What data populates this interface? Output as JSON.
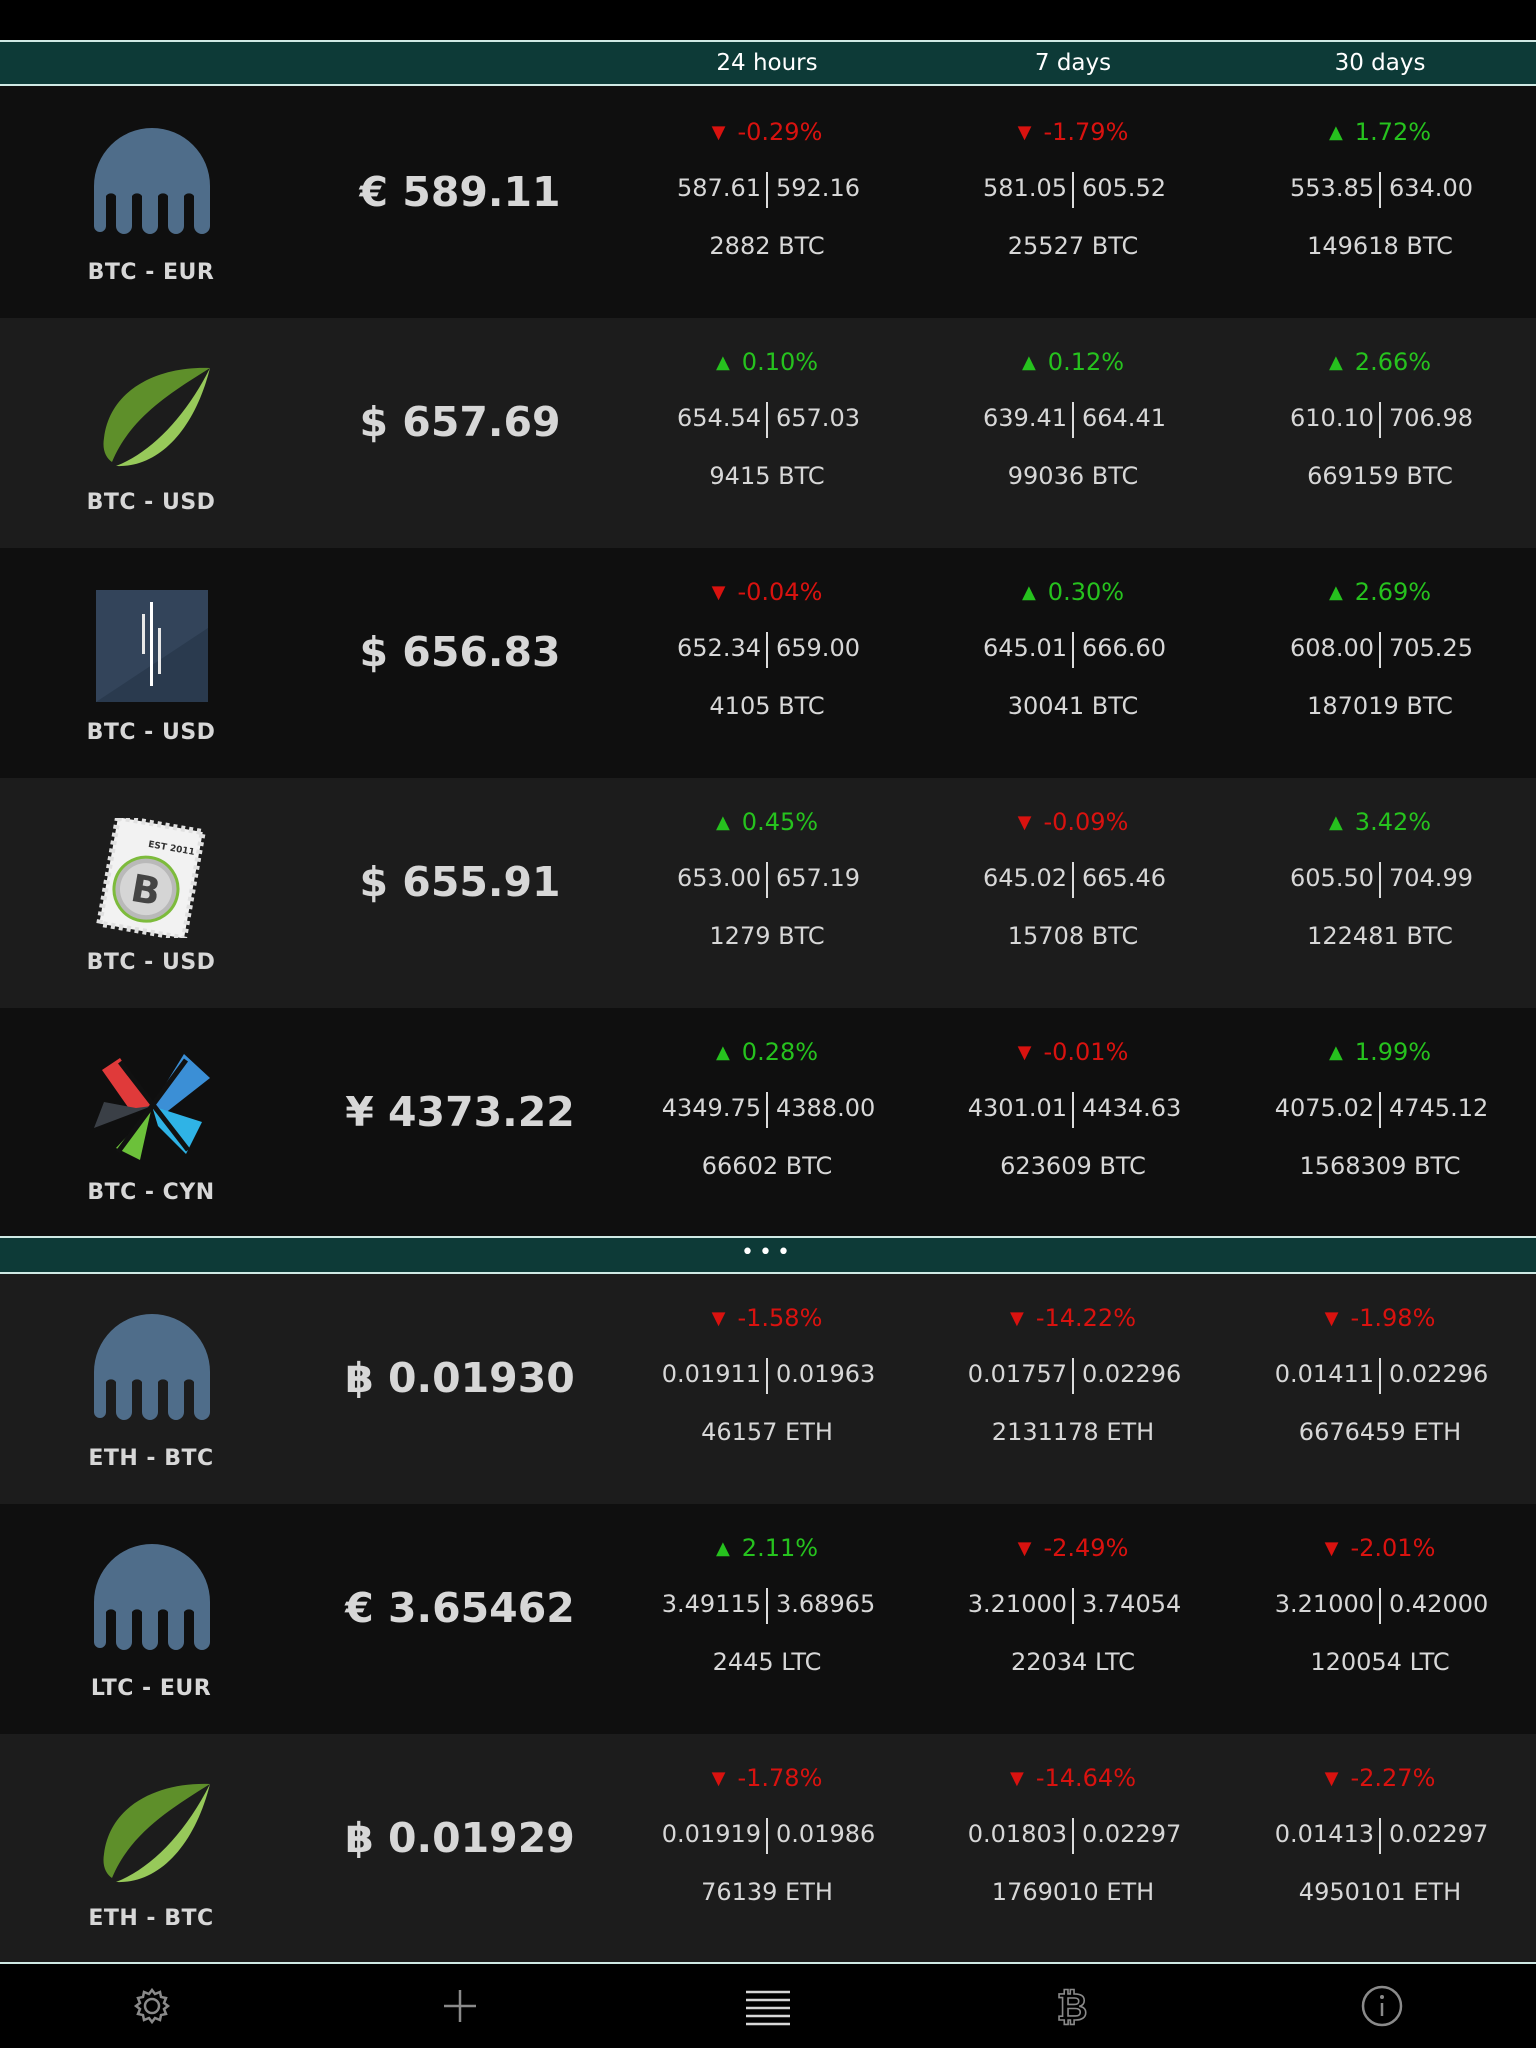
{
  "header": {
    "col_24h": "24 hours",
    "col_7d": "7 days",
    "col_30d": "30 days"
  },
  "divider": {
    "dots": "•••"
  },
  "rows": [
    {
      "logo": "kraken-icon",
      "pair": "BTC - EUR",
      "price": "€ 589.11",
      "h24": {
        "change": "-0.29%",
        "dir": "down",
        "low": "587.61",
        "high": "592.16",
        "volume": "2882 BTC"
      },
      "d7": {
        "change": "-1.79%",
        "dir": "down",
        "low": "581.05",
        "high": "605.52",
        "volume": "25527 BTC"
      },
      "d30": {
        "change": "1.72%",
        "dir": "up",
        "low": "553.85",
        "high": "634.00",
        "volume": "149618 BTC"
      }
    },
    {
      "logo": "bitfinex-leaf-icon",
      "pair": "BTC - USD",
      "price": "$ 657.69",
      "h24": {
        "change": "0.10%",
        "dir": "up",
        "low": "654.54",
        "high": "657.03",
        "volume": "9415 BTC"
      },
      "d7": {
        "change": "0.12%",
        "dir": "up",
        "low": "639.41",
        "high": "664.41",
        "volume": "99036 BTC"
      },
      "d30": {
        "change": "2.66%",
        "dir": "up",
        "low": "610.10",
        "high": "706.98",
        "volume": "669159 BTC"
      }
    },
    {
      "logo": "exchange-bars-icon",
      "pair": "BTC - USD",
      "price": "$ 656.83",
      "h24": {
        "change": "-0.04%",
        "dir": "down",
        "low": "652.34",
        "high": "659.00",
        "volume": "4105 BTC"
      },
      "d7": {
        "change": "0.30%",
        "dir": "up",
        "low": "645.01",
        "high": "666.60",
        "volume": "30041 BTC"
      },
      "d30": {
        "change": "2.69%",
        "dir": "up",
        "low": "608.00",
        "high": "705.25",
        "volume": "187019 BTC"
      }
    },
    {
      "logo": "bitstamp-stamp-icon",
      "pair": "BTC - USD",
      "price": "$ 655.91",
      "logo_text": "EST 2011",
      "h24": {
        "change": "0.45%",
        "dir": "up",
        "low": "653.00",
        "high": "657.19",
        "volume": "1279 BTC"
      },
      "d7": {
        "change": "-0.09%",
        "dir": "down",
        "low": "645.02",
        "high": "665.46",
        "volume": "15708 BTC"
      },
      "d30": {
        "change": "3.42%",
        "dir": "up",
        "low": "605.50",
        "high": "704.99",
        "volume": "122481 BTC"
      }
    },
    {
      "logo": "okcoin-cross-icon",
      "pair": "BTC - CYN",
      "price": "¥ 4373.22",
      "h24": {
        "change": "0.28%",
        "dir": "up",
        "low": "4349.75",
        "high": "4388.00",
        "volume": "66602 BTC"
      },
      "d7": {
        "change": "-0.01%",
        "dir": "down",
        "low": "4301.01",
        "high": "4434.63",
        "volume": "623609 BTC"
      },
      "d30": {
        "change": "1.99%",
        "dir": "up",
        "low": "4075.02",
        "high": "4745.12",
        "volume": "1568309 BTC"
      }
    },
    {
      "logo": "kraken-icon",
      "pair": "ETH - BTC",
      "price": "฿ 0.01930",
      "h24": {
        "change": "-1.58%",
        "dir": "down",
        "low": "0.01911",
        "high": "0.01963",
        "volume": "46157 ETH"
      },
      "d7": {
        "change": "-14.22%",
        "dir": "down",
        "low": "0.01757",
        "high": "0.02296",
        "volume": "2131178 ETH"
      },
      "d30": {
        "change": "-1.98%",
        "dir": "down",
        "low": "0.01411",
        "high": "0.02296",
        "volume": "6676459 ETH"
      }
    },
    {
      "logo": "kraken-icon",
      "pair": "LTC - EUR",
      "price": "€ 3.65462",
      "h24": {
        "change": "2.11%",
        "dir": "up",
        "low": "3.49115",
        "high": "3.68965",
        "volume": "2445 LTC"
      },
      "d7": {
        "change": "-2.49%",
        "dir": "down",
        "low": "3.21000",
        "high": "3.74054",
        "volume": "22034 LTC"
      },
      "d30": {
        "change": "-2.01%",
        "dir": "down",
        "low": "3.21000",
        "high": "0.42000",
        "volume": "120054 LTC"
      }
    },
    {
      "logo": "bitfinex-leaf-icon",
      "pair": "ETH - BTC",
      "price": "฿ 0.01929",
      "h24": {
        "change": "-1.78%",
        "dir": "down",
        "low": "0.01919",
        "high": "0.01986",
        "volume": "76139 ETH"
      },
      "d7": {
        "change": "-14.64%",
        "dir": "down",
        "low": "0.01803",
        "high": "0.02297",
        "volume": "1769010 ETH"
      },
      "d30": {
        "change": "-2.27%",
        "dir": "down",
        "low": "0.01413",
        "high": "0.02297",
        "volume": "4950101 ETH"
      }
    }
  ],
  "tabbar": {
    "items": [
      "gear-icon",
      "plus-icon",
      "list-icon",
      "bitcoin-icon",
      "info-icon"
    ]
  },
  "colors": {
    "up": "#26c21e",
    "down": "#d9120f",
    "header_bg": "#0d3a37"
  }
}
